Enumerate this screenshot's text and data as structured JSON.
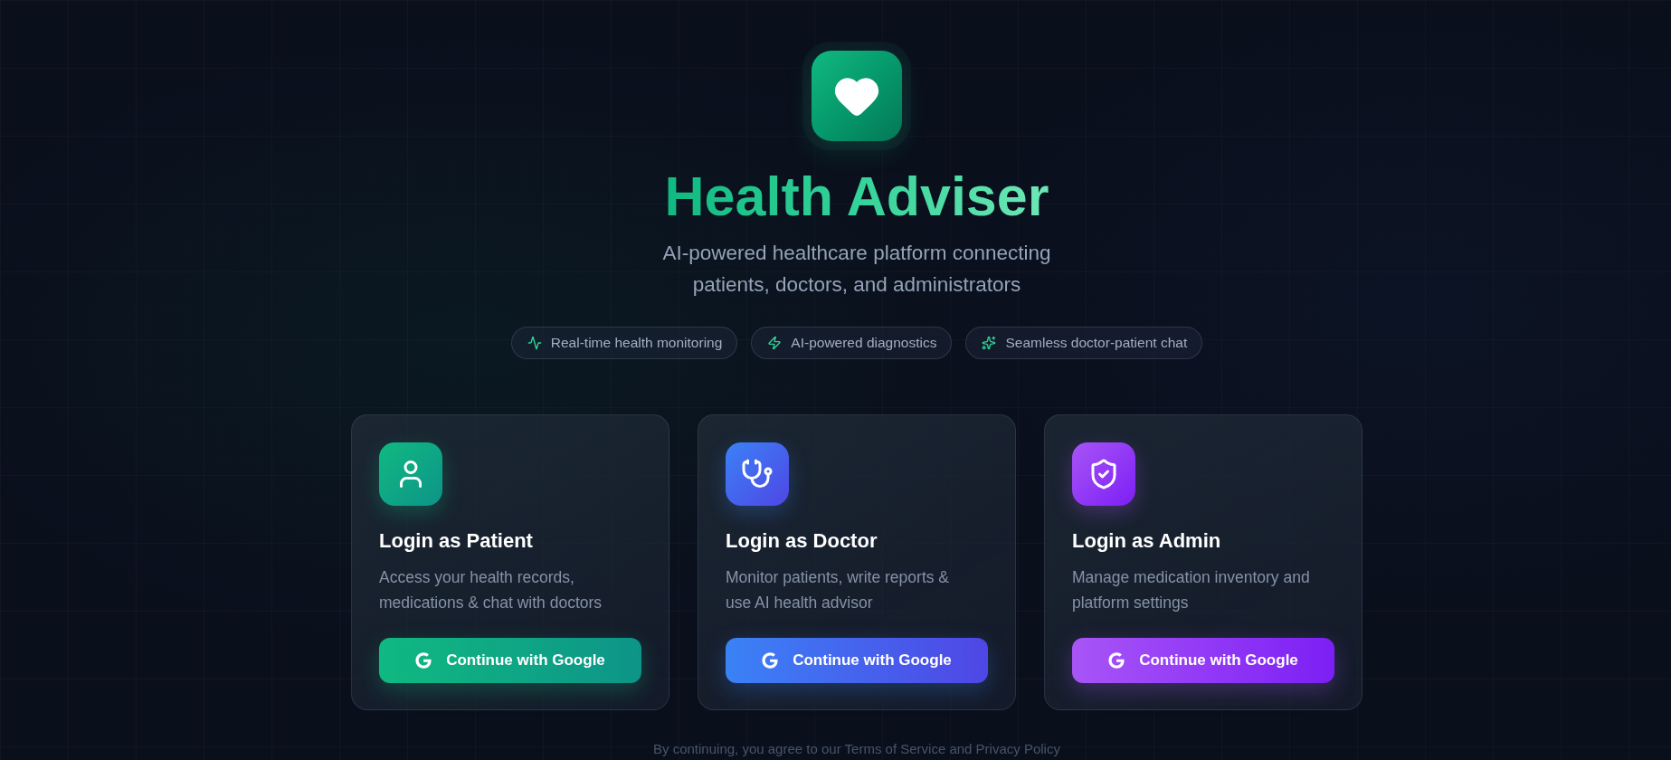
{
  "header": {
    "title": "Health Adviser",
    "subtitle": "AI-powered healthcare platform connecting patients, doctors, and administrators"
  },
  "features": [
    {
      "kind": "activity",
      "label": "Real-time health monitoring"
    },
    {
      "kind": "zap",
      "label": "AI-powered diagnostics"
    },
    {
      "kind": "sparkles",
      "label": "Seamless doctor-patient chat"
    }
  ],
  "login_cards": [
    {
      "kind": "patient",
      "title": "Login as Patient",
      "description": "Access your health records, medications & chat with doctors",
      "button": "Continue with Google"
    },
    {
      "kind": "doctor",
      "title": "Login as Doctor",
      "description": "Monitor patients, write reports & use AI health advisor",
      "button": "Continue with Google"
    },
    {
      "kind": "admin",
      "title": "Login as Admin",
      "description": "Manage medication inventory and platform settings",
      "button": "Continue with Google"
    }
  ],
  "footer": {
    "text": "By continuing, you agree to our Terms of Service and Privacy Policy"
  }
}
